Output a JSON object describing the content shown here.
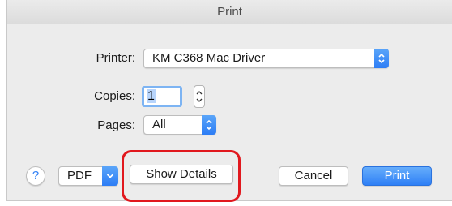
{
  "window": {
    "title": "Print"
  },
  "printer": {
    "label": "Printer:",
    "selected": "KM C368 Mac Driver"
  },
  "copies": {
    "label": "Copies:",
    "value": "1"
  },
  "pages": {
    "label": "Pages:",
    "selected": "All"
  },
  "footer": {
    "help_symbol": "?",
    "pdf_label": "PDF",
    "show_details_label": "Show Details",
    "cancel_label": "Cancel",
    "print_label": "Print"
  },
  "icons": {
    "popup_arrows": "updown-chevron-icon",
    "pdf_arrow": "chevron-down-icon",
    "copies_stepper": "stepper-icon",
    "help": "question-mark-icon"
  },
  "colors": {
    "accent": "#2f80f6",
    "highlight": "#e1181e",
    "dialog_bg": "#ececec"
  }
}
